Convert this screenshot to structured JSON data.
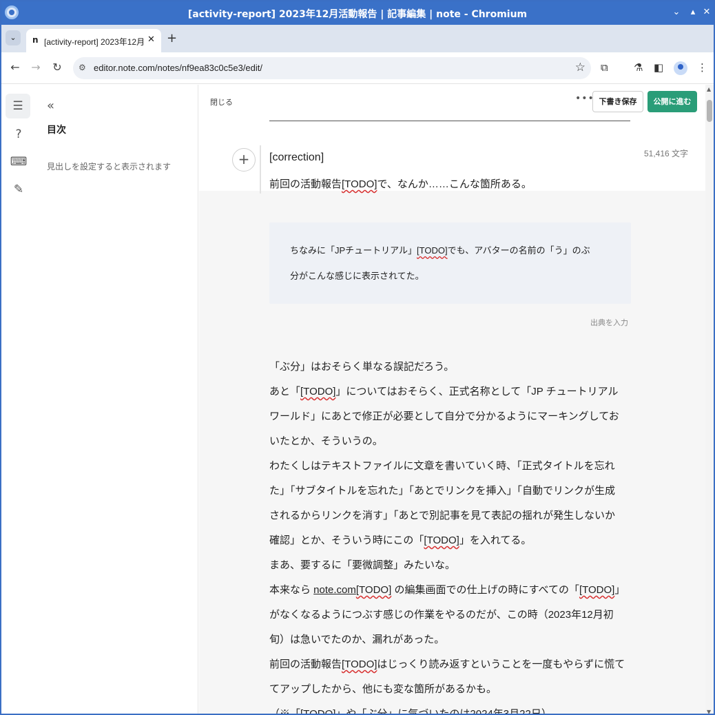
{
  "window": {
    "title": "[activity-report] 2023年12月活動報告 | 記事編集 | note - Chromium",
    "controls": {
      "minimize": "⌄",
      "restore": "▴",
      "close": "✕"
    }
  },
  "tabs": [
    {
      "favicon": "n",
      "title": "[activity-report] 2023年12月",
      "close": "✕"
    }
  ],
  "tabstrip": {
    "new_tab": "+",
    "dropdown": "⌄"
  },
  "toolbar": {
    "url": "editor.note.com/notes/nf9ea83c0c5e3/edit/",
    "back": "←",
    "forward": "→",
    "reload": "↻",
    "site_info": "⚙",
    "bookmark": "☆",
    "extensions": "⧉",
    "labs": "⚗",
    "sidepanel": "◧",
    "menu": "⋮"
  },
  "rail": {
    "toc_icon": "☰",
    "help_icon": "?",
    "keyboard_icon": "⌨",
    "magic_icon": "✎"
  },
  "toc": {
    "collapse": "«",
    "title": "目次",
    "empty_message": "見出しを設定すると表示されます"
  },
  "editor_header": {
    "close": "閉じる",
    "more": "•••",
    "save_draft": "下書き保存",
    "publish": "公開に進む"
  },
  "editor": {
    "char_count": "51,416 文字",
    "add": "+",
    "active_lines": [
      "[correction]",
      "前回の活動報告[TODO]で、なんか……こんな箇所ある。"
    ],
    "quote_lines": [
      "ちなみに「JPチュートリアル」[TODO]でも、アバターの名前の「う」のぶ",
      "分がこんな感じに表示されてた。"
    ],
    "cite_placeholder": "出典を入力",
    "body_lines": [
      "「ぶ分」はおそらく単なる誤記だろう。",
      "あと「[TODO]」についてはおそらく、正式名称として「JP チュートリアル",
      "ワールド」にあとで修正が必要として自分で分かるようにマーキングしてお",
      "いたとか、そういうの。",
      "わたくしはテキストファイルに文章を書いていく時、「正式タイトルを忘れ",
      "た」「サブタイトルを忘れた」「あとでリンクを挿入」「自動でリンクが生成",
      "されるからリンクを消す」「あとで別記事を見て表記の揺れが発生しないか",
      "確認」とか、そういう時にこの「[TODO]」を入れてる。",
      "まあ、要するに「要微調整」みたいな。",
      "本来なら note.com[TODO] の編集画面での仕上げの時にすべての「[TODO]」",
      "がなくなるようにつぶす感じの作業をやるのだが、この時（2023年12月初",
      "旬）は急いでたのか、漏れがあった。",
      "前回の活動報告[TODO]はじっくり読み返すということを一度もやらずに慌て",
      "てアップしたから、他にも変な箇所があるかも。",
      "（※「[TODO]」や「ぶ分」に気づいたのは2024年3月22日）"
    ]
  },
  "colors": {
    "titlebar": "#3a71c8",
    "publish_button": "#2a9d78",
    "spell_underline": "#d83030"
  }
}
